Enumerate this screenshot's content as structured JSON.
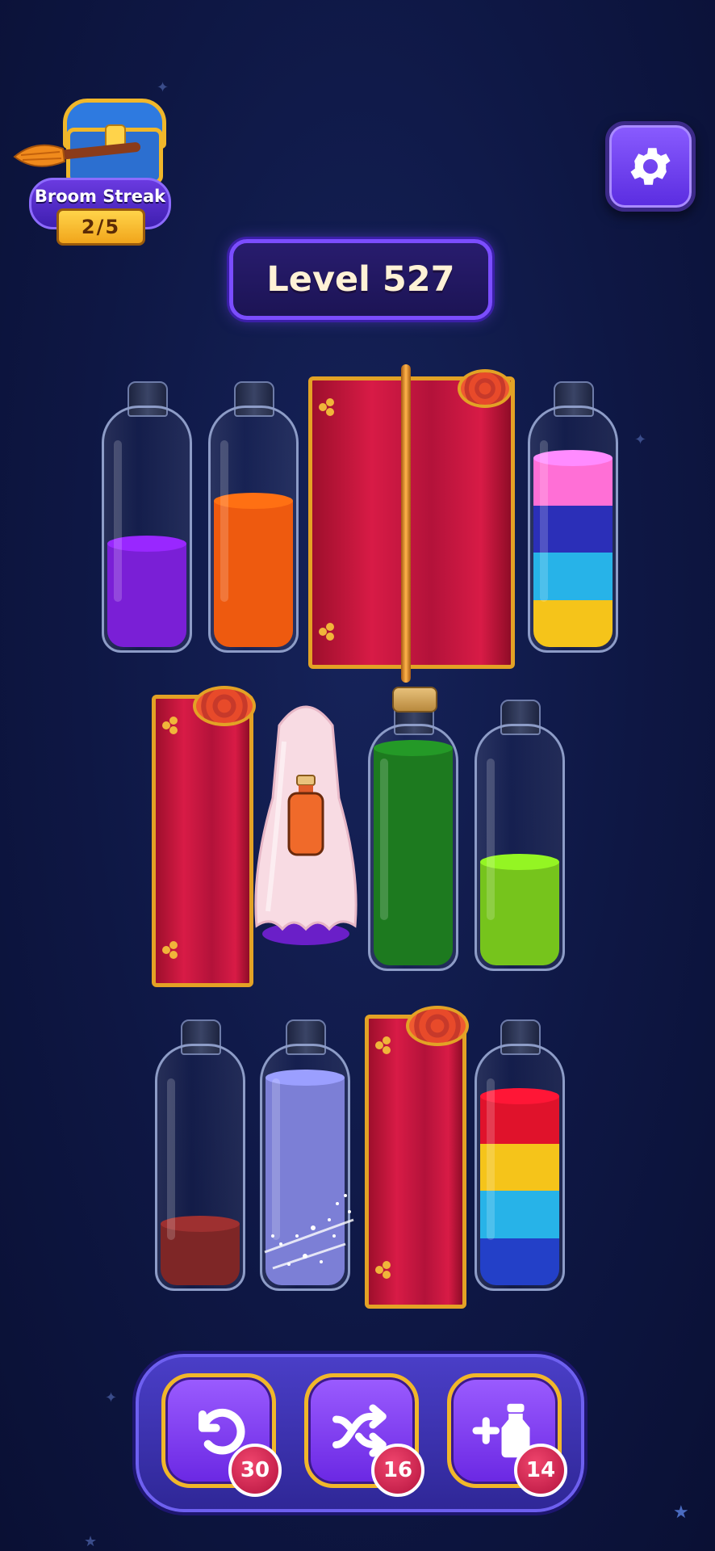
{
  "streak": {
    "title": "Broom Streak",
    "count": "2/5"
  },
  "level": {
    "label": "Level 527"
  },
  "powerups": [
    {
      "name": "undo",
      "count": "30"
    },
    {
      "name": "shuffle",
      "count": "16"
    },
    {
      "name": "add-bottle",
      "count": "14"
    }
  ],
  "colors": {
    "purple": "#7a1fd6",
    "orange": "#ee5a0f",
    "pink": "#ff6fd6",
    "navy": "#2b2fb8",
    "cyan": "#27b3e8",
    "yellow": "#f5c41a",
    "darkgreen": "#1d7a1f",
    "lime": "#76c41c",
    "maroon": "#7e2626",
    "lavender": "#7c7fd6",
    "red": "#e0122b",
    "blue": "#2340c8"
  },
  "bottles": [
    {
      "id": "r1b1",
      "layers": [
        "purple"
      ],
      "fill": [
        0.44
      ]
    },
    {
      "id": "r1b2",
      "layers": [
        "orange"
      ],
      "fill": [
        0.62
      ]
    },
    {
      "id": "r1b4",
      "layers": [
        "yellow",
        "cyan",
        "navy",
        "pink"
      ],
      "fill": [
        0.2,
        0.2,
        0.2,
        0.2
      ]
    },
    {
      "id": "r2b3",
      "layers": [
        "darkgreen"
      ],
      "fill": [
        0.92
      ],
      "corked": true
    },
    {
      "id": "r2b4",
      "layers": [
        "lime"
      ],
      "fill": [
        0.44
      ]
    },
    {
      "id": "r3b1",
      "layers": [
        "maroon"
      ],
      "fill": [
        0.26
      ]
    },
    {
      "id": "r3b2",
      "layers": [
        "lavender"
      ],
      "fill": [
        0.88
      ]
    },
    {
      "id": "r3b4",
      "layers": [
        "blue",
        "cyan",
        "yellow",
        "red"
      ],
      "fill": [
        0.2,
        0.2,
        0.2,
        0.2
      ]
    }
  ]
}
